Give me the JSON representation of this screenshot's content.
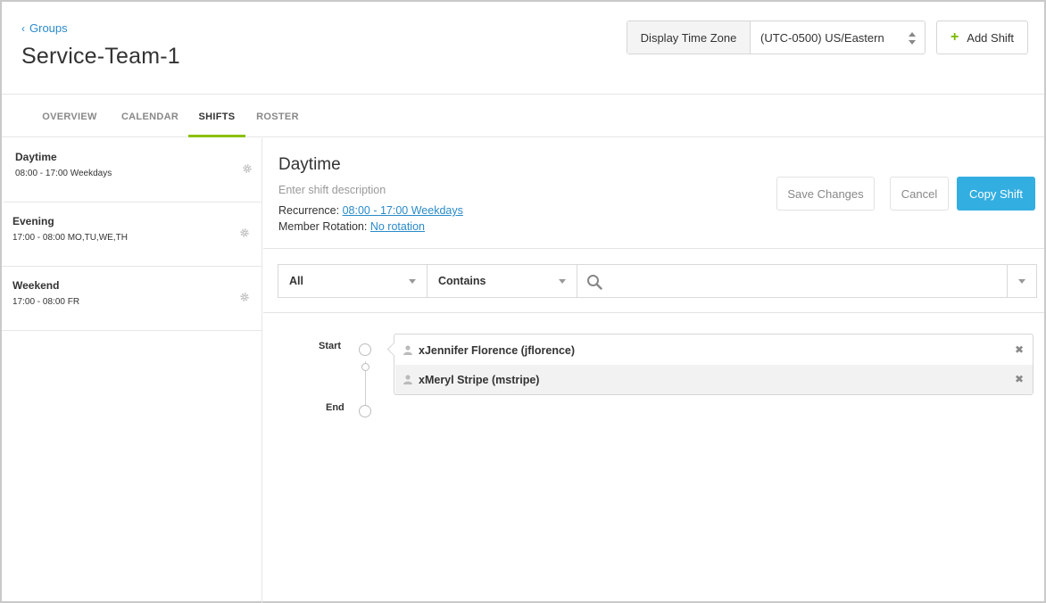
{
  "header": {
    "back_label": "Groups",
    "title": "Service-Team-1",
    "timezone_label": "Display Time Zone",
    "timezone_value": "(UTC-0500) US/Eastern",
    "add_shift_label": "Add Shift"
  },
  "tabs": [
    {
      "label": "OVERVIEW",
      "active": false
    },
    {
      "label": "CALENDAR",
      "active": false
    },
    {
      "label": "SHIFTS",
      "active": true
    },
    {
      "label": "ROSTER",
      "active": false
    }
  ],
  "shifts": [
    {
      "name": "Daytime",
      "time": "08:00 - 17:00 Weekdays",
      "selected": true
    },
    {
      "name": "Evening",
      "time": "17:00 - 08:00 MO,TU,WE,TH",
      "selected": false
    },
    {
      "name": "Weekend",
      "time": "17:00 - 08:00 FR",
      "selected": false
    }
  ],
  "detail": {
    "title": "Daytime",
    "description_placeholder": "Enter shift description",
    "recurrence_label": "Recurrence:",
    "recurrence_value": "08:00 - 17:00 Weekdays",
    "rotation_label": "Member Rotation:",
    "rotation_value": "No rotation",
    "save_label": "Save Changes",
    "cancel_label": "Cancel",
    "copy_label": "Copy Shift"
  },
  "filter": {
    "scope_value": "All",
    "operator_value": "Contains",
    "search_value": ""
  },
  "timeline": {
    "start_label": "Start",
    "end_label": "End"
  },
  "members": [
    {
      "name": "xJennifer Florence (jflorence)"
    },
    {
      "name": "xMeryl Stripe (mstripe)"
    }
  ],
  "colors": {
    "accent_blue": "#33aee0",
    "link_blue": "#2a8bc9",
    "tab_active_underline": "#8bc100",
    "add_plus_green": "#7ab800"
  }
}
